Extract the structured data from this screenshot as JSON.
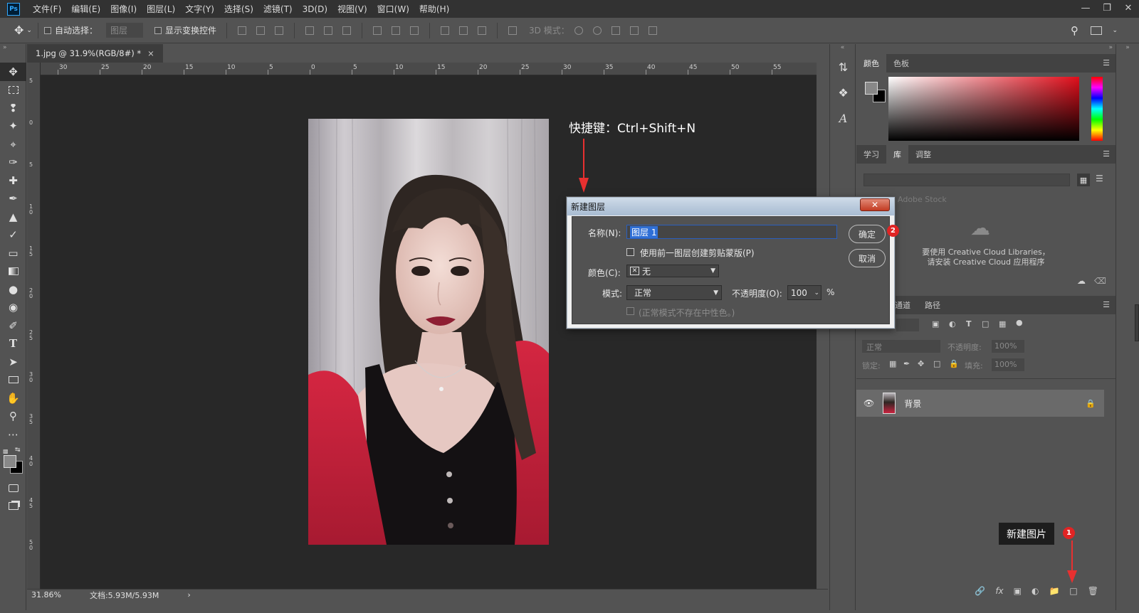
{
  "menubar": {
    "logo": "Ps",
    "items": [
      "文件(F)",
      "编辑(E)",
      "图像(I)",
      "图层(L)",
      "文字(Y)",
      "选择(S)",
      "滤镜(T)",
      "3D(D)",
      "视图(V)",
      "窗口(W)",
      "帮助(H)"
    ]
  },
  "options": {
    "auto_select_label": "自动选择：",
    "auto_select_value": "图层",
    "show_transform_label": "显示变换控件",
    "mode_3d_label": "3D 模式："
  },
  "document": {
    "tab_title": "1.jpg @ 31.9%(RGB/8#) *",
    "zoom": "31.86%",
    "doc_info": "文档:5.93M/5.93M"
  },
  "ruler": {
    "h_labels": [
      "30",
      "25",
      "20",
      "15",
      "10",
      "5",
      "0",
      "5",
      "10",
      "15",
      "20",
      "25",
      "30",
      "35",
      "40",
      "45",
      "50",
      "55"
    ],
    "v_labels": [
      "5",
      "0",
      "5",
      "10",
      "15",
      "20",
      "25",
      "30",
      "35",
      "40",
      "45",
      "50"
    ]
  },
  "annotations": {
    "shortcut": "快捷键：Ctrl+Shift+N",
    "new_layer_callout": "新建图片",
    "badge1": "1",
    "badge2": "2"
  },
  "dialog": {
    "title": "新建图层",
    "close": "✕",
    "name_label": "名称(N):",
    "name_value": "图层 1",
    "clip_label": "使用前一图层创建剪贴蒙版(P)",
    "color_label": "颜色(C):",
    "color_value": "无",
    "mode_label": "模式:",
    "mode_value": "正常",
    "opacity_label": "不透明度(O):",
    "opacity_value": "100",
    "opacity_unit": "%",
    "neutral_label": "(正常模式不存在中性色。)",
    "ok": "确定",
    "cancel": "取消"
  },
  "panels": {
    "color_tabs": [
      "颜色",
      "色板"
    ],
    "lib_tabs": [
      "学习",
      "库",
      "调整"
    ],
    "lib_stock": "Adobe Stock",
    "lib_msg1": "要使用 Creative Cloud Libraries，",
    "lib_msg2": "请安装 Creative Cloud 应用程序",
    "layer_tabs": [
      "通道",
      "路径"
    ],
    "blend_mode": "正常",
    "opacity_label": "不透明度:",
    "opacity_value": "100%",
    "lock_label": "锁定:",
    "fill_label": "填充:",
    "fill_value": "100%",
    "layer_name": "背景"
  },
  "colors": {
    "accent": "#31a8ff",
    "badge": "#e02424",
    "annotation_arrow": "#e83030"
  }
}
